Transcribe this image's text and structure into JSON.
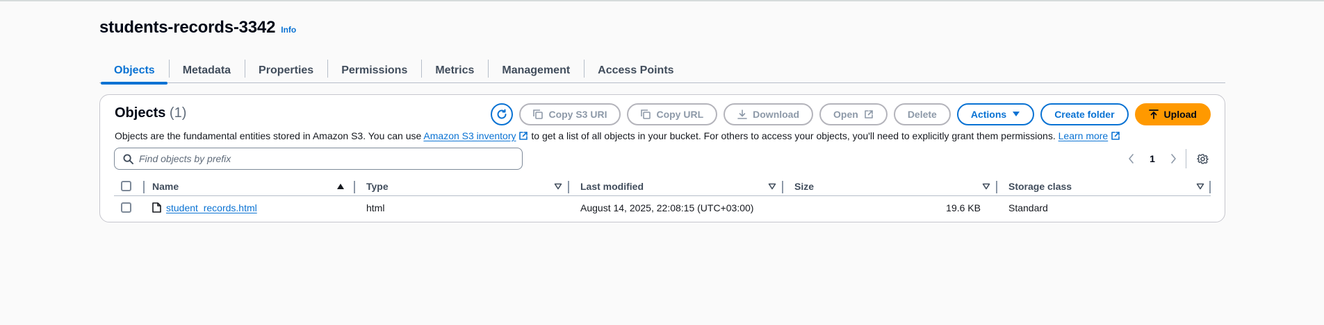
{
  "bucket": {
    "name": "students-records-3342",
    "info_label": "Info"
  },
  "tabs": [
    {
      "label": "Objects",
      "active": true
    },
    {
      "label": "Metadata",
      "active": false
    },
    {
      "label": "Properties",
      "active": false
    },
    {
      "label": "Permissions",
      "active": false
    },
    {
      "label": "Metrics",
      "active": false
    },
    {
      "label": "Management",
      "active": false
    },
    {
      "label": "Access Points",
      "active": false
    }
  ],
  "objects_panel": {
    "title": "Objects",
    "count": "(1)",
    "description": {
      "part1": "Objects are the fundamental entities stored in Amazon S3. You can use ",
      "inventory_link": "Amazon S3 inventory",
      "part2": " to get a list of all objects in your bucket. For others to access your objects, you'll need to explicitly grant them permissions. ",
      "learn_more": "Learn more"
    },
    "toolbar": {
      "refresh_icon": "refresh-icon",
      "copy_s3_uri": "Copy S3 URI",
      "copy_url": "Copy URL",
      "download": "Download",
      "open": "Open",
      "delete": "Delete",
      "actions": "Actions",
      "create_folder": "Create folder",
      "upload": "Upload"
    },
    "search": {
      "placeholder": "Find objects by prefix",
      "value": ""
    },
    "pagination": {
      "current_page": "1"
    },
    "table": {
      "columns": {
        "name": "Name",
        "type": "Type",
        "last_modified": "Last modified",
        "size": "Size",
        "storage_class": "Storage class"
      },
      "rows": [
        {
          "name": "student_records.html",
          "type": "html",
          "last_modified": "August 14, 2025, 22:08:15 (UTC+03:00)",
          "size": "19.6 KB",
          "storage_class": "Standard"
        }
      ]
    }
  },
  "colors": {
    "accent": "#0972d3",
    "upload": "#ff9900",
    "disabled": "#8d99a8"
  }
}
